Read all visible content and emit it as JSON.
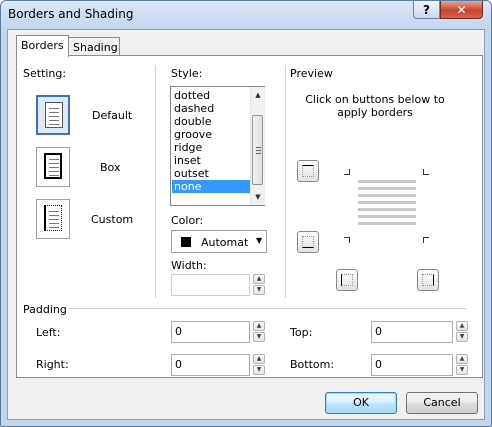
{
  "window": {
    "title": "Borders and Shading",
    "help_label": "?",
    "close_label": "✕"
  },
  "tabs": [
    {
      "label": "Borders"
    },
    {
      "label": "Shading"
    }
  ],
  "setting": {
    "header": "Setting:",
    "options": [
      {
        "label": "Default",
        "icon": "default-border-icon",
        "selected": true
      },
      {
        "label": "Box",
        "icon": "box-border-icon",
        "selected": false
      },
      {
        "label": "Custom",
        "icon": "custom-border-icon",
        "selected": false
      }
    ]
  },
  "style": {
    "header": "Style:",
    "items": [
      "dotted",
      "dashed",
      "double",
      "groove",
      "ridge",
      "inset",
      "outset",
      "none"
    ],
    "selected": "none"
  },
  "color": {
    "label": "Color:",
    "value": "Automatic",
    "swatch": "#000000"
  },
  "width": {
    "label": "Width:",
    "value": ""
  },
  "preview": {
    "header": "Preview",
    "instruction": "Click on buttons below to apply borders",
    "buttons": [
      "top-border-icon",
      "bottom-border-icon",
      "left-border-icon",
      "right-border-icon"
    ]
  },
  "padding": {
    "header": "Padding",
    "left_label": "Left:",
    "left_value": "0",
    "right_label": "Right:",
    "right_value": "0",
    "top_label": "Top:",
    "top_value": "0",
    "bottom_label": "Bottom:",
    "bottom_value": "0"
  },
  "buttons": {
    "ok": "OK",
    "cancel": "Cancel"
  },
  "colors": {
    "selection": "#3399ff",
    "title_bar": "#c4d6ec",
    "close_button": "#c6462f"
  }
}
